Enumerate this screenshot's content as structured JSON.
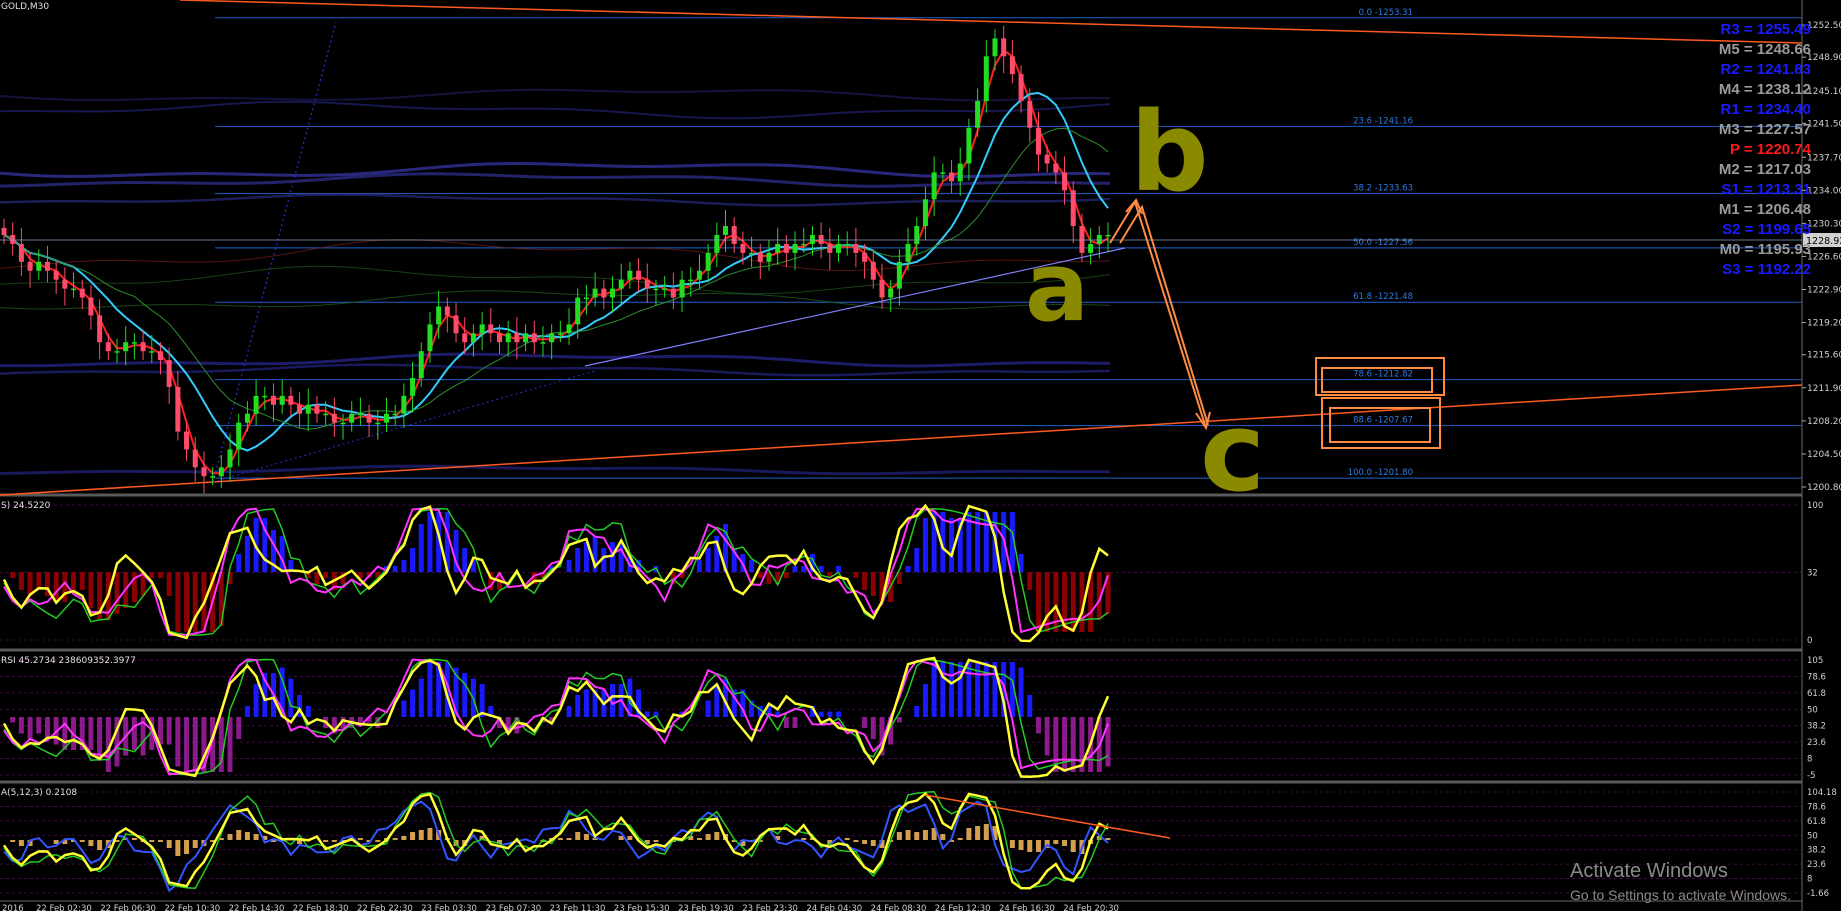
{
  "window": {
    "title": "GOLD,M30"
  },
  "colors": {
    "background": "#000000",
    "pivot_blue": "#1a1aff",
    "pivot_gray": "#9a9a9a",
    "pivot_red": "#ff1a1a",
    "fib_line": "#1e63c8",
    "trendline": "#ff5a1f",
    "annotation_orange": "#ff8c42",
    "annotation_olive": "#8a8a00"
  },
  "price_axis": {
    "labels": [
      "1252.50",
      "1248.90",
      "1245.10",
      "1241.50",
      "1237.70",
      "1234.00",
      "1230.30",
      "1226.60",
      "1222.90",
      "1219.20",
      "1215.60",
      "1211.90",
      "1208.20",
      "1204.50",
      "1200.80"
    ],
    "current_price": "1228.92"
  },
  "fib_levels": [
    {
      "label": "0.0 -1253.31",
      "price": 1253.31
    },
    {
      "label": "23.6 -1241.16",
      "price": 1241.16
    },
    {
      "label": "38.2 -1233.63",
      "price": 1233.63
    },
    {
      "label": "50.0 -1227.56",
      "price": 1227.56
    },
    {
      "label": "61.8 -1221.48",
      "price": 1221.48
    },
    {
      "label": "78.6 -1212.82",
      "price": 1212.82
    },
    {
      "label": "88.6 -1207.67",
      "price": 1207.67
    },
    {
      "label": "100.0 -1201.80",
      "price": 1201.8
    }
  ],
  "pivots": [
    {
      "label": "R3 = 1255.49",
      "kind": "blue"
    },
    {
      "label": "M5 = 1248.66",
      "kind": "gray"
    },
    {
      "label": "R2 = 1241.83",
      "kind": "blue"
    },
    {
      "label": "M4 = 1238.12",
      "kind": "gray"
    },
    {
      "label": "R1 = 1234.40",
      "kind": "blue"
    },
    {
      "label": "M3 = 1227.57",
      "kind": "gray"
    },
    {
      "label": "P  = 1220.74",
      "kind": "red"
    },
    {
      "label": "M2 = 1217.03",
      "kind": "gray"
    },
    {
      "label": "S1 = 1213.31",
      "kind": "blue"
    },
    {
      "label": "M1 = 1206.48",
      "kind": "gray"
    },
    {
      "label": "S2 = 1199.65",
      "kind": "blue"
    },
    {
      "label": "M0 = 1195.93",
      "kind": "gray"
    },
    {
      "label": "S3 = 1192.22",
      "kind": "blue"
    }
  ],
  "annotations": {
    "wave_b": "b",
    "wave_a": "a",
    "wave_c": "c"
  },
  "panels": {
    "macd": {
      "label": "S) 24.5220",
      "axis": [
        "100",
        "32",
        "0"
      ]
    },
    "rsi": {
      "label": "RSI 45.2734 2386093​52.3977",
      "axis": [
        "105",
        "78.6",
        "61.8",
        "50",
        "38.2",
        "23.6",
        "8",
        "-5"
      ]
    },
    "stoch": {
      "label": "A(5,12,3) 0.2108",
      "axis": [
        "104.18",
        "78.6",
        "61.8",
        "50",
        "38.2",
        "23.6",
        "8",
        "-1.66"
      ]
    }
  },
  "time_axis": [
    "2016",
    "22 Feb 02:30",
    "22 Feb 06:30",
    "22 Feb 10:30",
    "22 Feb 14:30",
    "22 Feb 18:30",
    "22 Feb 22:30",
    "23 Feb 03:30",
    "23 Feb 07:30",
    "23 Feb 11:30",
    "23 Feb 15:30",
    "23 Feb 19:30",
    "23 Feb 23:30",
    "24 Feb 04:30",
    "24 Feb 08:30",
    "24 Feb 12:30",
    "24 Feb 16:30",
    "24 Feb 20:30"
  ],
  "chart_data": {
    "type": "candlestick",
    "title": "GOLD,M30",
    "ylim": [
      1200.0,
      1254.5
    ],
    "series": [
      {
        "name": "price",
        "close": [
          1229,
          1228,
          1226,
          1225,
          1226,
          1225,
          1224,
          1223,
          1223,
          1222,
          1220,
          1217,
          1216,
          1216,
          1217,
          1217,
          1216,
          1216,
          1215,
          1212,
          1207,
          1205,
          1203,
          1202,
          1202,
          1203,
          1205,
          1208,
          1209,
          1211,
          1211,
          1210,
          1211,
          1210,
          1209,
          1210,
          1209,
          1209,
          1208,
          1208,
          1209,
          1209,
          1208,
          1208,
          1209,
          1209,
          1211,
          1213,
          1216,
          1219,
          1221,
          1220,
          1218,
          1217,
          1218,
          1219,
          1218,
          1217,
          1218,
          1217,
          1218,
          1217,
          1217,
          1218,
          1218,
          1219,
          1222,
          1222,
          1223,
          1222,
          1223,
          1224,
          1225,
          1224,
          1223,
          1223,
          1223,
          1222,
          1224,
          1224,
          1225,
          1227,
          1229,
          1230,
          1228,
          1227,
          1227,
          1226,
          1227,
          1228,
          1227,
          1228,
          1228,
          1229,
          1228,
          1227,
          1228,
          1228,
          1227,
          1226,
          1224,
          1222,
          1223,
          1226,
          1228,
          1230,
          1233,
          1236,
          1236,
          1235,
          1237,
          1241,
          1244,
          1249,
          1251,
          1249,
          1247,
          1244,
          1241,
          1238,
          1237,
          1236,
          1234,
          1230,
          1227,
          1228,
          1229,
          1229
        ]
      }
    ]
  }
}
